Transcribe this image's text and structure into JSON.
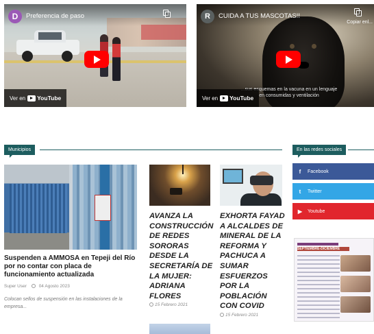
{
  "videos": [
    {
      "avatar_letter": "D",
      "title": "Preferencia de paso",
      "watch_label": "Ver en",
      "youtube_label": "YouTube"
    },
    {
      "avatar_letter": "R",
      "title": "CUIDA A TUS MASCOTAS!!",
      "copy_link_label": "Copiar enl...",
      "subtitle_text": "...sus esquemas en la vacuna en un lenguaje en consumidas y ventilación",
      "watch_label": "Ver en",
      "youtube_label": "YouTube"
    }
  ],
  "sections": {
    "municipios_label": "Municipios",
    "social_label": "En las redes sociales"
  },
  "featured_news": {
    "title": "Suspenden a AMMOSA en Tepeji del Río por no contar con placa de funcionamiento actualizada",
    "author": "Super User",
    "date": "04 Agosto 2023",
    "description": "Colocan sellos de suspensión en las instalaciones de la empresa..."
  },
  "news": [
    {
      "title": "AVANZA LA CONSTRUCCIÓN DE REDES SORORAS DESDE LA SECRETARÍA DE LA MUJER: ADRIANA FLORES",
      "date": "15 Febrero 2021"
    },
    {
      "title": "EXHORTA FAYAD A ALCALDES DE MINERAL DE LA REFORMA Y PACHUCA A SUMAR ESFUERZOS POR LA POBLACIÓN CON COVID",
      "date": "15 Febrero 2021"
    }
  ],
  "social": [
    {
      "icon": "facebook-icon",
      "glyph": "f",
      "label": "Facebook",
      "color": "#3b5998"
    },
    {
      "icon": "twitter-icon",
      "glyph": "t",
      "label": "Twitter",
      "color": "#33a6e6"
    },
    {
      "icon": "youtube-icon",
      "glyph": "▶",
      "label": "Youtube",
      "color": "#e1262d"
    }
  ],
  "poster": {
    "heading": "SEPTIEMBRE-DICIEMBRE"
  },
  "colors": {
    "accent": "#1d5d5f",
    "youtube_red": "#ff0000"
  }
}
